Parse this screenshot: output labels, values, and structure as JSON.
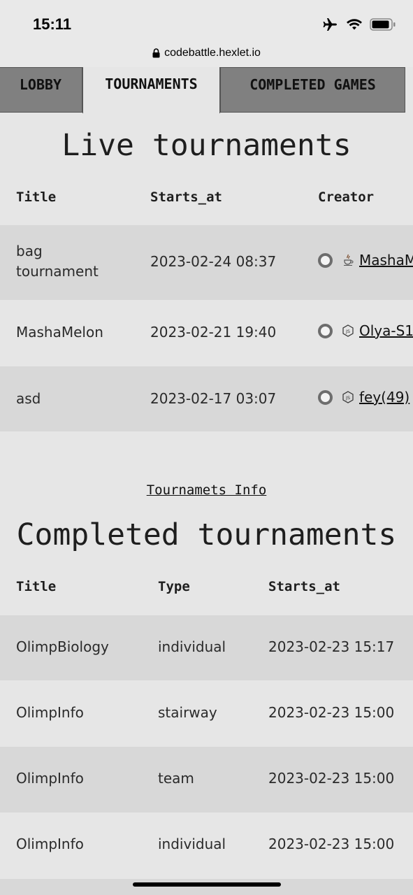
{
  "status_bar": {
    "time": "15:11",
    "url": "codebattle.hexlet.io"
  },
  "tabs": [
    {
      "label": "LOBBY",
      "active": false
    },
    {
      "label": "TOURNAMENTS",
      "active": true
    },
    {
      "label": "COMPLETED GAMES",
      "active": false
    }
  ],
  "live": {
    "title": "Live tournaments",
    "headers": {
      "title": "Title",
      "starts_at": "Starts_at",
      "creator": "Creator"
    },
    "rows": [
      {
        "title": "bag tournament",
        "starts_at": "2023-02-24 08:37",
        "creator": "MashaM",
        "lang_icon": "java-icon"
      },
      {
        "title": "MashaMelon",
        "starts_at": "2023-02-21 19:40",
        "creator": "Olya-S1",
        "lang_icon": "js-icon"
      },
      {
        "title": "asd",
        "starts_at": "2023-02-17 03:07",
        "creator": "fey(49)",
        "lang_icon": "js-icon"
      }
    ]
  },
  "info_link": "Tournamets Info",
  "completed": {
    "title": "Completed tournaments",
    "headers": {
      "title": "Title",
      "type": "Type",
      "starts_at": "Starts_at"
    },
    "rows": [
      {
        "title": "OlimpBiology",
        "type": "individual",
        "starts_at": "2023-02-23 15:17"
      },
      {
        "title": "OlimpInfo",
        "type": "stairway",
        "starts_at": "2023-02-23 15:00"
      },
      {
        "title": "OlimpInfo",
        "type": "team",
        "starts_at": "2023-02-23 15:00"
      },
      {
        "title": "OlimpInfo",
        "type": "individual",
        "starts_at": "2023-02-23 15:00"
      }
    ]
  },
  "colors": {
    "background": "#e6e6e6",
    "row_shade": "#d8d8d8",
    "tab_inactive": "#808080"
  }
}
